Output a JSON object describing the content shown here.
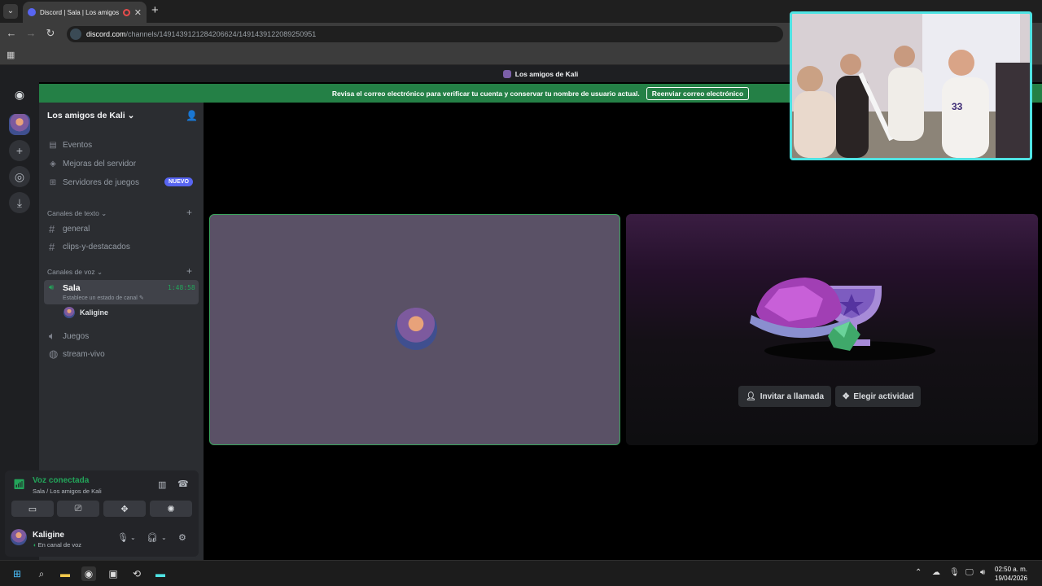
{
  "browser": {
    "tab_title": "Discord | Sala | Los amigos d",
    "url_domain": "discord.com",
    "url_path": "/channels/1491439121284206624/1491439122089250951"
  },
  "server": {
    "name": "Los amigos de Kali",
    "header_title": "Los amigos de Kali"
  },
  "banner": {
    "message": "Revisa el correo electrónico para verificar tu cuenta y conservar tu nombre de usuario actual.",
    "button": "Reenviar correo electrónico"
  },
  "sidebar": {
    "menu": [
      {
        "label": "Eventos",
        "icon": "calendar-icon"
      },
      {
        "label": "Mejoras del servidor",
        "icon": "boost-icon"
      },
      {
        "label": "Servidores de juegos",
        "icon": "gamepad-icon"
      }
    ],
    "new_badge": "NUEVO",
    "text_category": "Canales de texto",
    "text_channels": [
      "general",
      "clips-y-destacados"
    ],
    "voice_category": "Canales de voz",
    "active_voice": {
      "name": "Sala",
      "time": "1:48:58",
      "status_placeholder": "Establece un estado de canal",
      "user": "Kaligine"
    },
    "voice_channels": [
      "Juegos",
      "stream-vivo"
    ]
  },
  "voice_panel": {
    "title": "Voz conectada",
    "subtitle": "Sala / Los amigos de Kali"
  },
  "user": {
    "name": "Kaligine",
    "status": "En canal de voz"
  },
  "activity": {
    "invite": "Invitar a llamada",
    "choose": "Elegir actividad"
  },
  "taskbar": {
    "time": "02:50 a. m.",
    "date": "19/04/2026"
  },
  "colors": {
    "green": "#23a55a",
    "blurple": "#5865f2",
    "cam_border": "#4fe3e3"
  }
}
